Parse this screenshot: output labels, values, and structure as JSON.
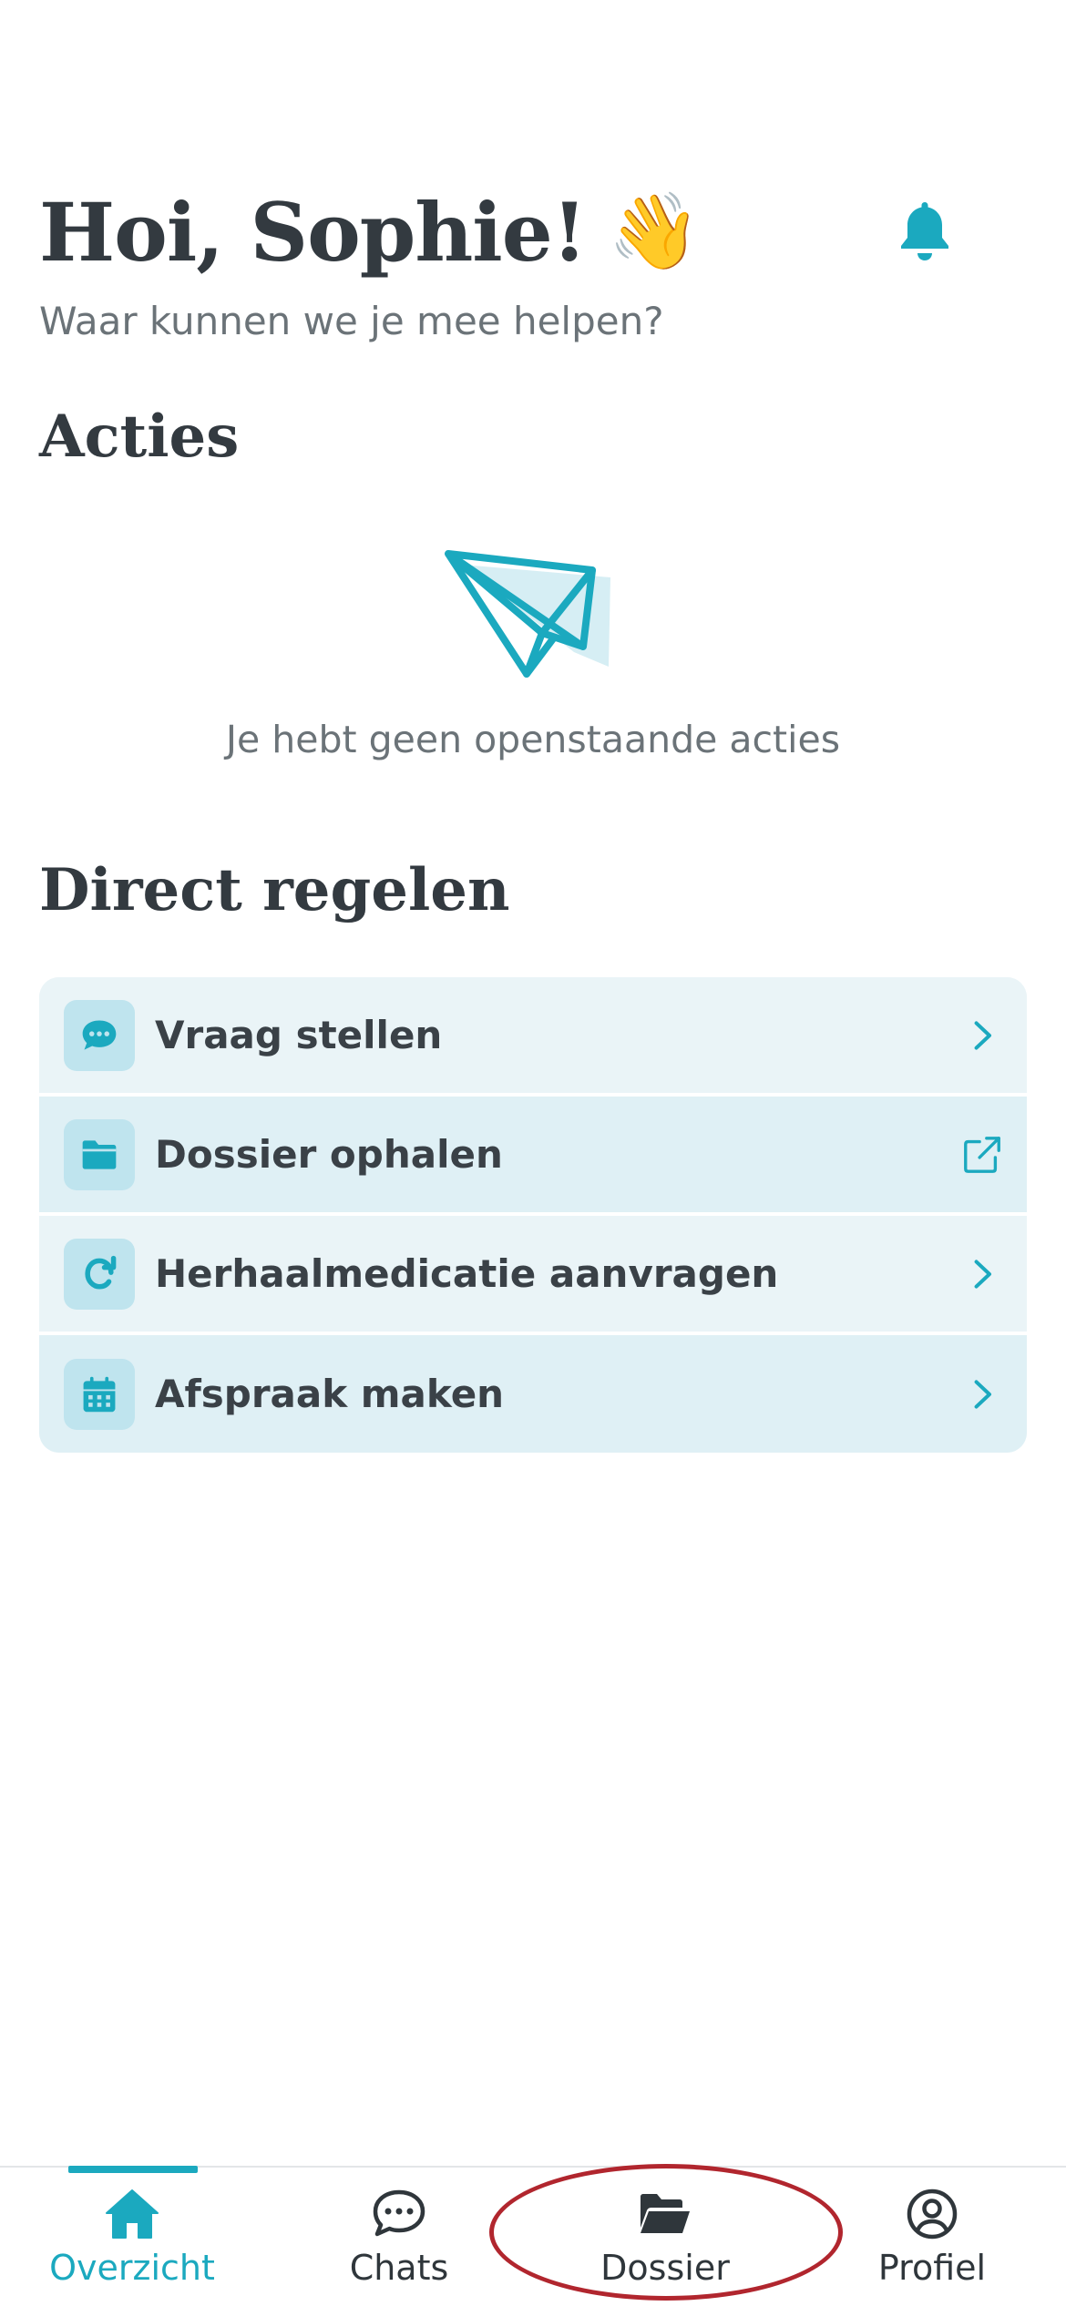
{
  "header": {
    "greeting": "Hoi, Sophie!",
    "wave_emoji": "👋",
    "subtitle": "Waar kunnen we je mee helpen?",
    "bell_icon": "bell-icon"
  },
  "actions_section": {
    "title": "Acties",
    "empty_text": "Je hebt geen openstaande acties",
    "illustration": "paper-plane-icon"
  },
  "direct_section": {
    "title": "Direct regelen",
    "items": [
      {
        "label": "Vraag stellen",
        "icon": "chat-bubble-icon",
        "trail": "chevron-right-icon"
      },
      {
        "label": "Dossier ophalen",
        "icon": "folder-icon",
        "trail": "external-link-icon"
      },
      {
        "label": "Herhaalmedicatie aanvragen",
        "icon": "refresh-icon",
        "trail": "chevron-right-icon"
      },
      {
        "label": "Afspraak maken",
        "icon": "calendar-icon",
        "trail": "chevron-right-icon"
      }
    ]
  },
  "bottom_nav": {
    "items": [
      {
        "label": "Overzicht",
        "icon": "home-icon",
        "active": true
      },
      {
        "label": "Chats",
        "icon": "chat-icon",
        "active": false
      },
      {
        "label": "Dossier",
        "icon": "folder-open-icon",
        "active": false
      },
      {
        "label": "Profiel",
        "icon": "user-circle-icon",
        "active": false
      }
    ]
  },
  "colors": {
    "accent": "#1ba9bf",
    "text": "#333a40",
    "muted": "#6b7378",
    "row_bg": "#eaf4f7",
    "icon_bg": "#bfe4ee",
    "annotation": "#b1262e"
  }
}
